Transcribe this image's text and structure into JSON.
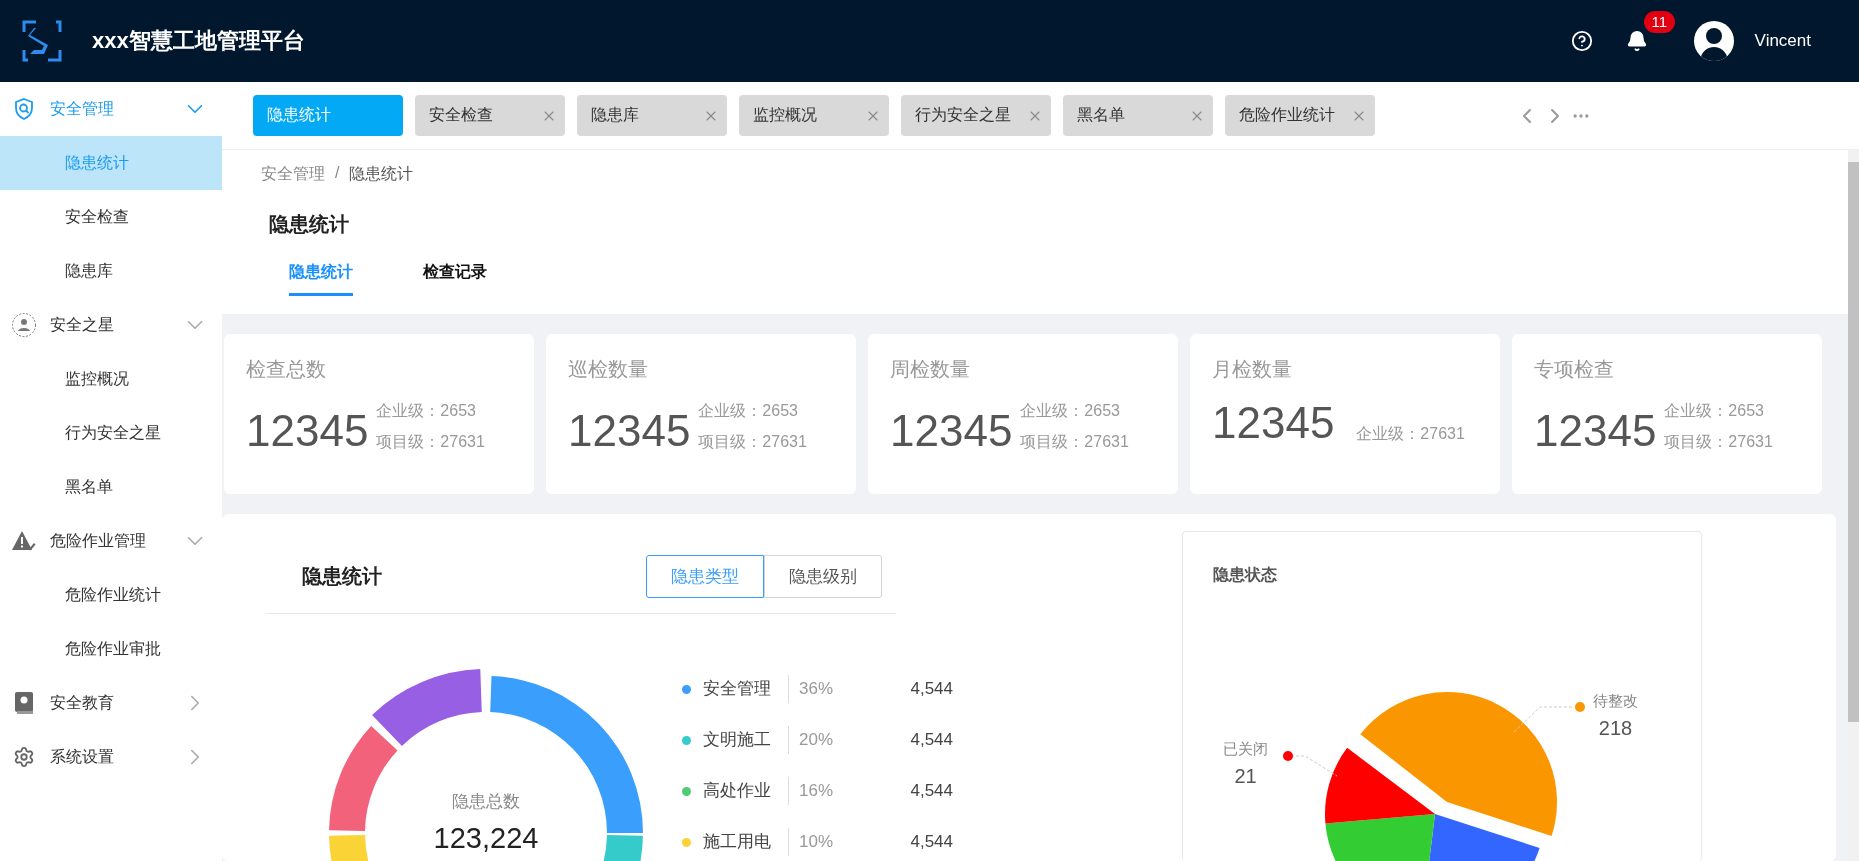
{
  "header": {
    "title": "xxx智慧工地管理平台",
    "notifications": "11",
    "user": "Vincent"
  },
  "sidebar": {
    "groups": [
      {
        "label": "安全管理",
        "kind": "shield",
        "selected": true,
        "expanded": true,
        "children": [
          {
            "label": "隐患统计",
            "selected": true
          },
          {
            "label": "安全检查",
            "selected": false
          },
          {
            "label": "隐患库",
            "selected": false
          }
        ]
      },
      {
        "label": "安全之星",
        "kind": "person",
        "selected": false,
        "expanded": true,
        "children": [
          {
            "label": "监控概况",
            "selected": false
          },
          {
            "label": "行为安全之星",
            "selected": false
          },
          {
            "label": "黑名单",
            "selected": false
          }
        ]
      },
      {
        "label": "危险作业管理",
        "kind": "warning",
        "selected": false,
        "expanded": true,
        "children": [
          {
            "label": "危险作业统计",
            "selected": false
          },
          {
            "label": "危险作业审批",
            "selected": false
          }
        ]
      },
      {
        "label": "安全教育",
        "kind": "book",
        "selected": false,
        "expanded": false
      },
      {
        "label": "系统设置",
        "kind": "gear",
        "selected": false,
        "expanded": false
      }
    ]
  },
  "tabs": [
    {
      "label": "隐患统计",
      "selected": true
    },
    {
      "label": "安全检查",
      "selected": false
    },
    {
      "label": "隐患库",
      "selected": false
    },
    {
      "label": "监控概况",
      "selected": false
    },
    {
      "label": "行为安全之星",
      "selected": false
    },
    {
      "label": "黑名单",
      "selected": false
    },
    {
      "label": "危险作业统计",
      "selected": false
    }
  ],
  "page": {
    "breadcrumb": [
      "安全管理",
      "隐患统计"
    ],
    "breadcrumb_separator": "/",
    "title": "隐患统计",
    "subtabs": [
      {
        "label": "隐患统计",
        "selected": true
      },
      {
        "label": "检查记录",
        "selected": false
      }
    ]
  },
  "cards": [
    {
      "title": "检查总数",
      "total": "12345",
      "lines": [
        "企业级：2653",
        "项目级：27631"
      ]
    },
    {
      "title": "巡检数量",
      "total": "12345",
      "lines": [
        "企业级：2653",
        "项目级：27631"
      ]
    },
    {
      "title": "周检数量",
      "total": "12345",
      "lines": [
        "企业级：2653",
        "项目级：27631"
      ]
    },
    {
      "title": "月检数量",
      "total": "12345",
      "lines": [
        "企业级：27631"
      ]
    },
    {
      "title": "专项检查",
      "total": "12345",
      "lines": [
        "企业级：2653",
        "项目级：27631"
      ]
    }
  ],
  "hazard_stats": {
    "title": "隐患统计",
    "toggle": [
      {
        "label": "隐患类型",
        "selected": true
      },
      {
        "label": "隐患级别",
        "selected": false
      }
    ],
    "center_label": "隐患总数",
    "center_total": "123,224",
    "legend": [
      {
        "name": "安全管理",
        "percent": "36%",
        "count": "4,544",
        "color": "#3a9efd"
      },
      {
        "name": "文明施工",
        "percent": "20%",
        "count": "4,544",
        "color": "#36cbcb"
      },
      {
        "name": "高处作业",
        "percent": "16%",
        "count": "4,544",
        "color": "#4ecb73"
      },
      {
        "name": "施工用电",
        "percent": "10%",
        "count": "4,544",
        "color": "#fad337"
      }
    ]
  },
  "hazard_status": {
    "title": "隐患状态",
    "labels": [
      {
        "name": "待整改",
        "value": "218",
        "color": "#fa9600"
      },
      {
        "name": "已关闭",
        "value": "21",
        "color": "#ff0000"
      }
    ]
  }
}
